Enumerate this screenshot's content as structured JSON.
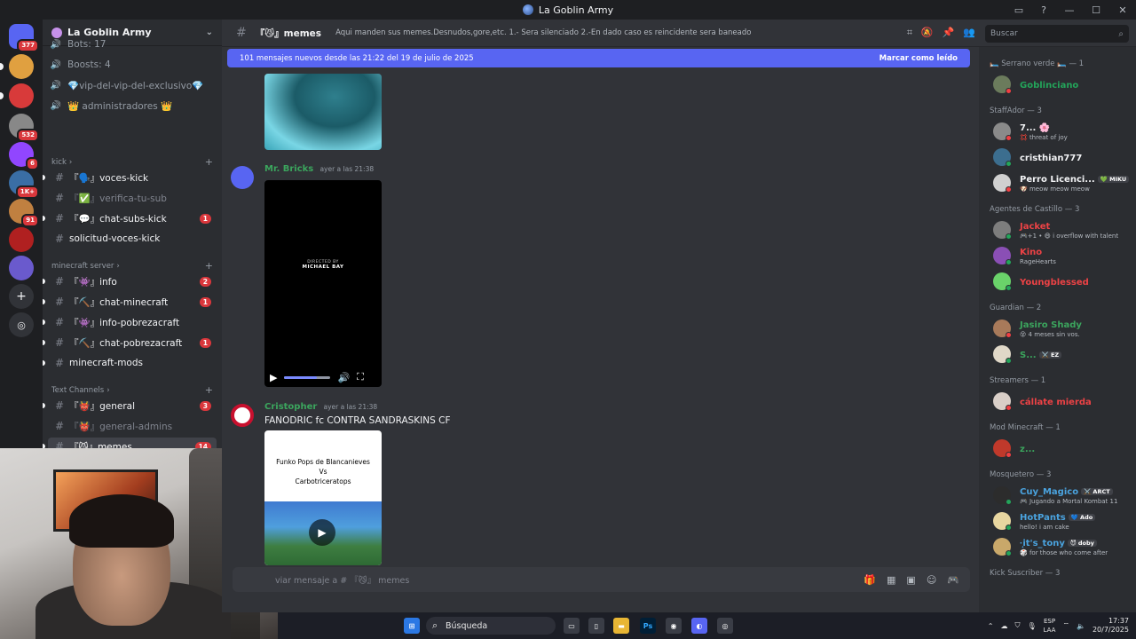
{
  "window": {
    "title": "La Goblin Army"
  },
  "guilds": [
    {
      "badge": "377",
      "color": "#5865f2"
    },
    {
      "badge": "",
      "color": "#e0a040"
    },
    {
      "badge": "",
      "color": "#d83a3a"
    },
    {
      "badge": "532",
      "color": "#888888"
    },
    {
      "badge": "6",
      "color": "#9146ff"
    },
    {
      "badge": "1K+",
      "color": "#3a6ea5"
    },
    {
      "badge": "91",
      "color": "#c08040"
    },
    {
      "badge": "",
      "color": "#b02020"
    },
    {
      "badge": "",
      "color": "#6a5acd"
    }
  ],
  "server": {
    "name": "La Goblin Army",
    "voice_stats": [
      "Bots: 17",
      "Boosts: 4"
    ],
    "voice_channels": [
      "💎vip-del-vip-del-exclusivo💎",
      "👑 administradores 👑"
    ],
    "categories": {
      "kick": "kick",
      "minecraft": "minecraft server",
      "text": "Text Channels"
    },
    "kick_channels": [
      {
        "name": "『🗣️』voces-kick",
        "badge": "",
        "muted": false,
        "unread": true
      },
      {
        "name": "『✅』verifica-tu-sub",
        "badge": "",
        "muted": true,
        "unread": false
      },
      {
        "name": "『💬』chat-subs-kick",
        "badge": "1",
        "muted": false,
        "unread": true
      },
      {
        "name": "solicitud-voces-kick",
        "badge": "",
        "muted": false,
        "unread": false
      }
    ],
    "minecraft_channels": [
      {
        "name": "『👾』info",
        "badge": "2",
        "muted": false,
        "unread": true
      },
      {
        "name": "『⛏️』chat-minecraft",
        "badge": "1",
        "muted": false,
        "unread": true
      },
      {
        "name": "『👾』info-pobrezacraft",
        "badge": "",
        "muted": false,
        "unread": true
      },
      {
        "name": "『⛏️』chat-pobrezacraft",
        "badge": "1",
        "muted": false,
        "unread": true
      },
      {
        "name": "minecraft-mods",
        "badge": "",
        "muted": false,
        "unread": true
      }
    ],
    "text_channels": [
      {
        "name": "『👹』general",
        "badge": "3",
        "muted": false,
        "unread": true
      },
      {
        "name": "『👹』general-admins",
        "badge": "",
        "muted": true,
        "unread": false
      },
      {
        "name": "『😼』memes",
        "badge": "14",
        "muted": false,
        "unread": true,
        "active": true
      },
      {
        "name": "『🎰』ludopatia",
        "badge": "",
        "muted": false,
        "unread": true
      }
    ]
  },
  "chat": {
    "channel_name": "『😼』memes",
    "topic": "Aqui manden sus memes.Desnudos,gore,etc. 1.- Sera silenciado 2.-En dado caso es reincidente sera baneado",
    "new_messages_banner": "101 mensajes nuevos desde las 21:22 del 19 de julio de 2025",
    "mark_read": "Marcar como leído",
    "search_placeholder": "Buscar",
    "messages": [
      {
        "author": "Mr. Bricks",
        "timestamp": "ayer a las 21:38",
        "text": "",
        "author_color": "#3ba55d"
      },
      {
        "author": "Cristopher",
        "timestamp": "ayer a las 21:38",
        "text": "FANODRIC fc CONTRA SANDRASKINS CF",
        "author_color": "#3ba55d"
      }
    ],
    "video_credit": {
      "line1": "DIRECTED BY",
      "line2": "MICHAEL BAY"
    },
    "video_progress": 0.7,
    "video2_caption": [
      "Funko Pops de Blancanieves",
      "Vs",
      "Carbotriceratops"
    ],
    "composer_placeholder": "viar mensaje a # 『😼』 memes"
  },
  "members": {
    "groups": [
      {
        "title": "🛏️ Serrano verde 🛏️ — 1",
        "members": [
          {
            "name": "Goblinciano",
            "color": "#23a55a",
            "sub": "",
            "tag": "",
            "status": "#f23f43"
          }
        ]
      },
      {
        "title": "StaffAdor — 3",
        "members": [
          {
            "name": "7... 🌸",
            "color": "#f2f3f5",
            "sub": "💢 threat of joy",
            "tag": "",
            "status": "#f23f43"
          },
          {
            "name": "cristhian777",
            "color": "#f2f3f5",
            "sub": "",
            "tag": "",
            "status": "#23a55a"
          },
          {
            "name": "Perro Licenci...",
            "color": "#f2f3f5",
            "sub": "🐶 meow meow meow",
            "tag": "💚 MIKU",
            "status": "#f23f43"
          }
        ]
      },
      {
        "title": "Agentes de Castillo — 3",
        "members": [
          {
            "name": "Jacket",
            "color": "#ed4245",
            "sub": "🎮+1 • 😄 i overflow with talent",
            "tag": "",
            "status": "#23a55a"
          },
          {
            "name": "Kino",
            "color": "#ed4245",
            "sub": "RageHearts",
            "tag": "",
            "status": "#23a55a"
          },
          {
            "name": "Youngblessed",
            "color": "#ed4245",
            "sub": "",
            "tag": "",
            "status": "#23a55a"
          }
        ]
      },
      {
        "title": "Guardian — 2",
        "members": [
          {
            "name": "Jasiro Shady",
            "color": "#3ba55d",
            "sub": "😵 4 meses sin vos.",
            "tag": "",
            "status": "#f23f43"
          },
          {
            "name": "S...",
            "color": "#3ba55d",
            "sub": "",
            "tag": "⚔️ EZ",
            "status": "#23a55a"
          }
        ]
      },
      {
        "title": "Streamers — 1",
        "members": [
          {
            "name": "cállate mierda",
            "color": "#ed4245",
            "sub": "",
            "tag": "",
            "status": "#f23f43"
          }
        ]
      },
      {
        "title": "Mod Minecraft — 1",
        "members": [
          {
            "name": "z...",
            "color": "#3ba55d",
            "sub": "",
            "tag": "",
            "status": "#f23f43"
          }
        ]
      },
      {
        "title": "Mosquetero — 3",
        "members": [
          {
            "name": "Cuy_Magico",
            "color": "#4aa3df",
            "sub": "🎮 Jugando a Mortal Kombat 11",
            "tag": "⚔️ ARCT",
            "status": "#23a55a"
          },
          {
            "name": "HotPants",
            "color": "#4aa3df",
            "sub": "hello! i am cake",
            "tag": "💙 Ado",
            "status": "#23a55a"
          },
          {
            "name": "·̩͙it's_tony",
            "color": "#4aa3df",
            "sub": "🎲 for those who come after",
            "tag": "😈 doby",
            "status": "#23a55a"
          }
        ]
      },
      {
        "title": "Kick Suscriber — 3",
        "members": []
      }
    ]
  },
  "taskbar": {
    "search": "Búsqueda",
    "lang": "ESP",
    "lang2": "LAA",
    "time": "17:37",
    "date": "20/7/2025"
  }
}
